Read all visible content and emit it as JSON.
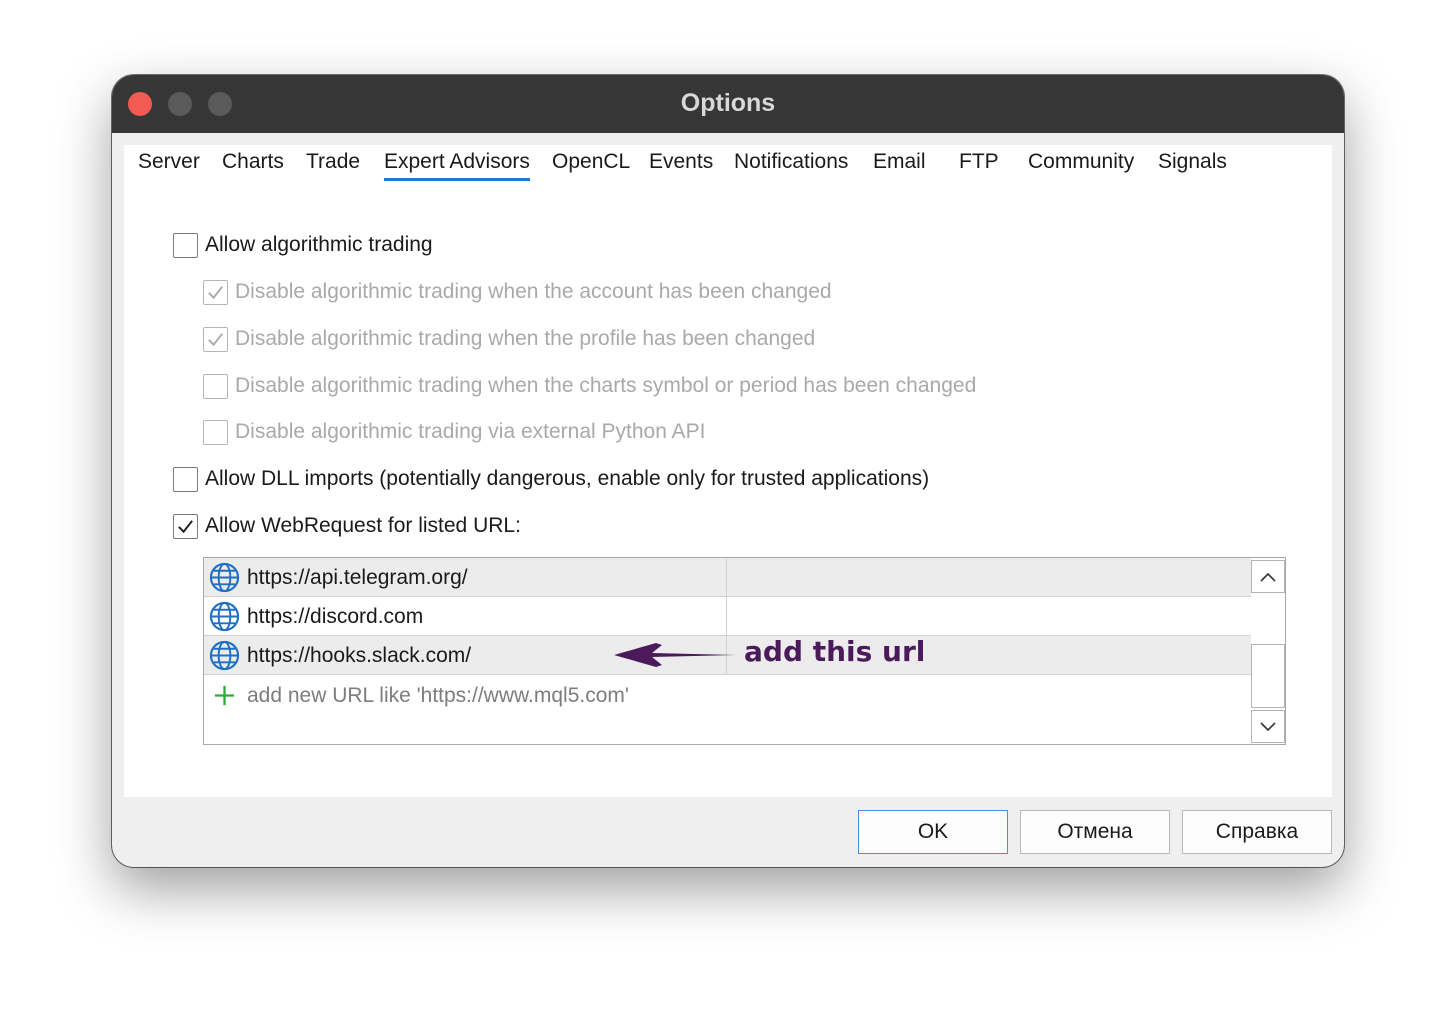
{
  "window": {
    "title": "Options"
  },
  "tabs": [
    {
      "label": "Server"
    },
    {
      "label": "Charts"
    },
    {
      "label": "Trade"
    },
    {
      "label": "Expert Advisors",
      "active": true
    },
    {
      "label": "OpenCL"
    },
    {
      "label": "Events"
    },
    {
      "label": "Notifications"
    },
    {
      "label": "Email"
    },
    {
      "label": "FTP"
    },
    {
      "label": "Community"
    },
    {
      "label": "Signals"
    }
  ],
  "options": {
    "allow_algo": {
      "label": "Allow algorithmic trading",
      "checked": false
    },
    "disable_account": {
      "label": "Disable algorithmic trading when the account has been changed",
      "checked": true,
      "enabled": false
    },
    "disable_profile": {
      "label": "Disable algorithmic trading when the profile has been changed",
      "checked": true,
      "enabled": false
    },
    "disable_symbol": {
      "label": "Disable algorithmic trading when the charts symbol or period has been changed",
      "checked": false,
      "enabled": false
    },
    "disable_python": {
      "label": "Disable algorithmic trading via external Python API",
      "checked": false,
      "enabled": false
    },
    "allow_dll": {
      "label": "Allow DLL imports (potentially dangerous, enable only for trusted applications)",
      "checked": false
    },
    "allow_webrequest": {
      "label": "Allow WebRequest for listed URL:",
      "checked": true
    }
  },
  "url_list": {
    "urls": [
      "https://api.telegram.org/",
      "https://discord.com",
      "https://hooks.slack.com/"
    ],
    "add_placeholder": "add new URL like 'https://www.mql5.com'"
  },
  "annotation": {
    "text": "add this url",
    "color": "#4b1a5a"
  },
  "buttons": {
    "ok": "OK",
    "cancel": "Отмена",
    "help": "Справка"
  },
  "colors": {
    "accent": "#1e79d4",
    "titlebar": "#363636",
    "close": "#f25a52",
    "add_icon": "#2eaa3a"
  }
}
